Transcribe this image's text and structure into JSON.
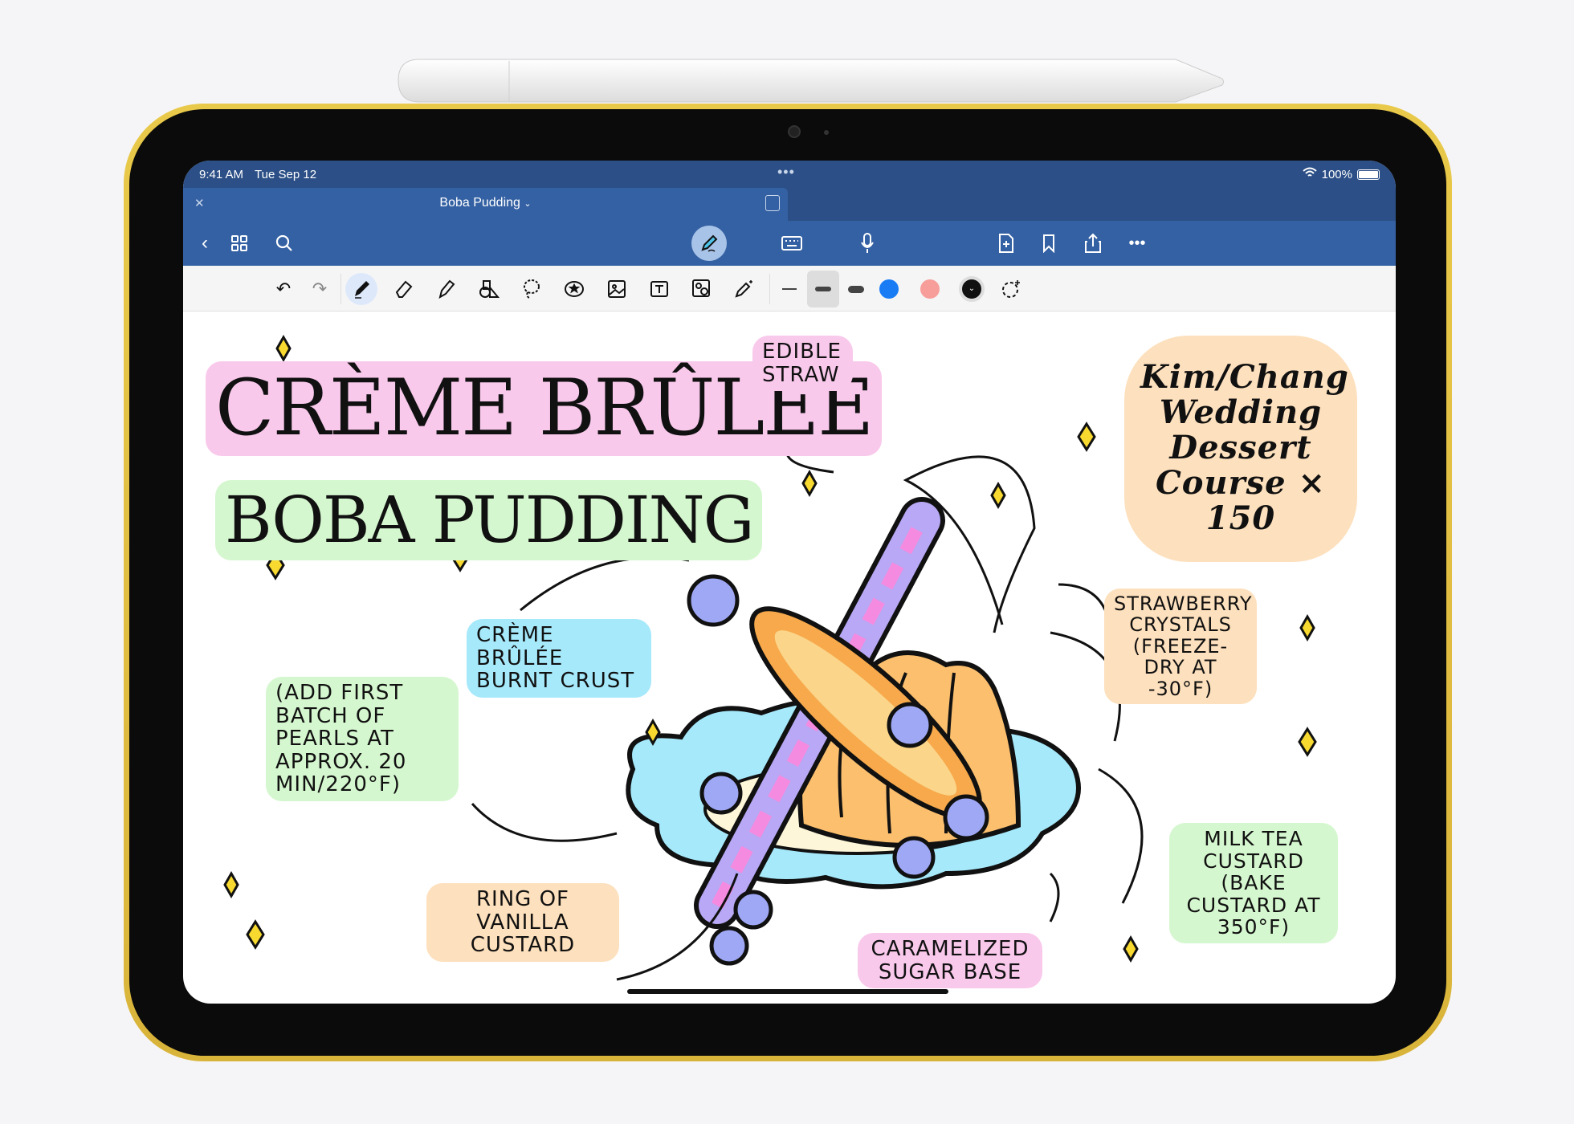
{
  "status_bar": {
    "time": "9:41 AM",
    "date": "Tue Sep 12",
    "battery": "100%",
    "battery_level": 1.0
  },
  "document": {
    "title": "Boba Pudding",
    "close_icon": "close-icon",
    "split_icon": "split-view-icon"
  },
  "nav": {
    "left": [
      "back-icon",
      "grid-icon",
      "search-icon"
    ],
    "center": [
      "draw-mode-icon",
      "keyboard-icon",
      "microphone-icon"
    ],
    "right": [
      "new-page-icon",
      "bookmark-icon",
      "share-icon",
      "more-icon"
    ]
  },
  "drawing_toolbar": {
    "tools": [
      "undo",
      "redo",
      "pen",
      "eraser",
      "highlighter",
      "shapes",
      "lasso",
      "sticker",
      "image",
      "text-box",
      "image-search",
      "magic-pencil"
    ],
    "selected_tool": "pen",
    "stroke_widths": [
      "thin",
      "medium",
      "thick"
    ],
    "selected_width": "medium",
    "colors": [
      "#1a7cf5",
      "#f79e9a",
      "#111111"
    ],
    "selected_color": "#111111"
  },
  "canvas": {
    "title": "Crème Brûlée",
    "subtitle": "Boba Pudding",
    "notes": {
      "straw": "Edible straw",
      "event": "Kim/Chang Wedding Dessert Course × 150",
      "crystals": "Strawberry crystals (freeze-dry at -30°F)",
      "crust": "Crème brûlée burnt crust",
      "pearls": "(Add first batch of pearls at approx. 20 min/220°F)",
      "ring": "Ring of vanilla custard",
      "base": "Caramelized sugar base",
      "custard": "Milk tea custard (bake custard at 350°F)"
    },
    "highlight_colors": {
      "pink": "#f9c9ec",
      "green": "#d5f7cf",
      "blue": "#a6e9fb",
      "peach": "#fde0bd"
    }
  }
}
